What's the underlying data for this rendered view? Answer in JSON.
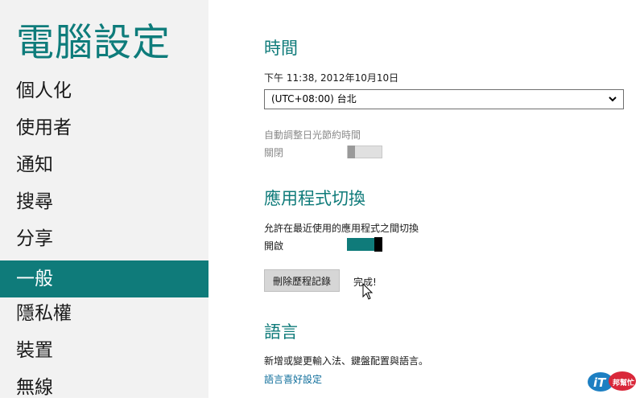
{
  "app": {
    "title": "電腦設定"
  },
  "sidebar": {
    "items": [
      {
        "label": "個人化"
      },
      {
        "label": "使用者"
      },
      {
        "label": "通知"
      },
      {
        "label": "搜尋"
      },
      {
        "label": "分享"
      },
      {
        "label": "一般",
        "selected": true
      },
      {
        "label": "隱私權"
      },
      {
        "label": "裝置"
      },
      {
        "label": "無線"
      }
    ]
  },
  "time": {
    "heading": "時間",
    "current_datetime": "下午 11:38, 2012年10月10日",
    "timezone_selected": "(UTC+08:00) 台北",
    "dst_label": "自動調整日光節約時間",
    "dst_state": "關閉",
    "dst_on": false
  },
  "app_switching": {
    "heading": "應用程式切換",
    "allow_label": "允許在最近使用的應用程式之間切換",
    "allow_state": "開啟",
    "allow_on": true,
    "clear_history_button": "刪除歷程記錄",
    "done_text": "完成!"
  },
  "language": {
    "heading": "語言",
    "description": "新增或變更輸入法、鍵盤配置與語言。",
    "link": "語言喜好設定"
  },
  "logo_text": "iT邦幫忙",
  "colors": {
    "accent": "#0f7b7a",
    "sidebar_bg": "#f2f2f2",
    "link": "#0f6e9b"
  }
}
